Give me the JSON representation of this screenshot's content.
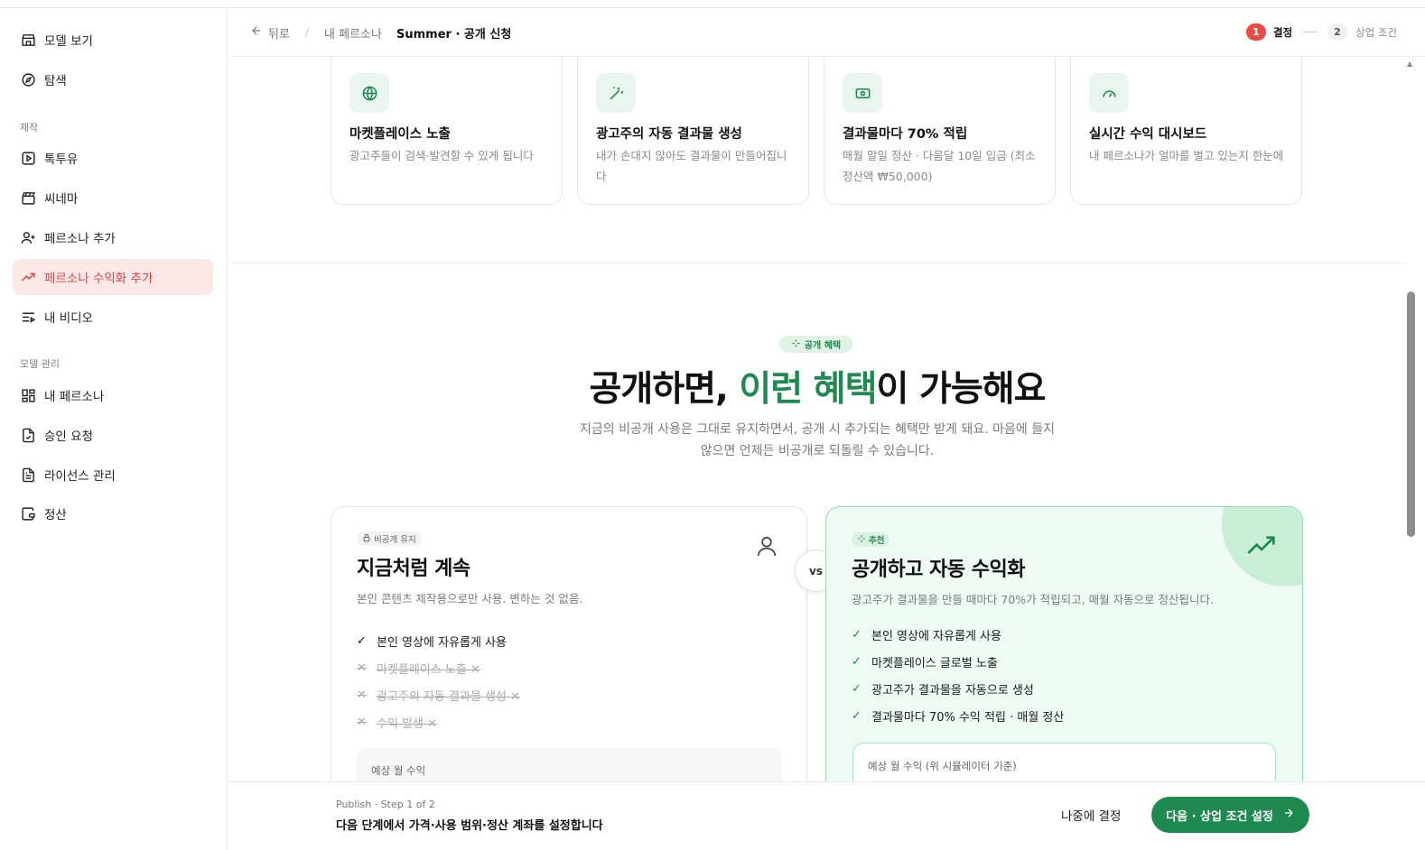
{
  "sidebar": {
    "items_top": [
      {
        "label": "모델 보기",
        "icon": "store-icon"
      },
      {
        "label": "탐색",
        "icon": "compass-icon"
      }
    ],
    "section_make": "제작",
    "items_make": [
      {
        "label": "톡투유",
        "icon": "play-square-icon"
      },
      {
        "label": "씨네마",
        "icon": "clapperboard-icon"
      },
      {
        "label": "페르소나 추가",
        "icon": "user-plus-icon"
      },
      {
        "label": "페르소나 수익화 추가",
        "icon": "trending-up-icon"
      },
      {
        "label": "내 비디오",
        "icon": "video-list-icon"
      }
    ],
    "section_manage": "모델 관리",
    "items_manage": [
      {
        "label": "내 페르소나",
        "icon": "grid-icon"
      },
      {
        "label": "승인 요청",
        "icon": "file-check-icon"
      },
      {
        "label": "라이선스 관리",
        "icon": "file-text-icon"
      },
      {
        "label": "정산",
        "icon": "wallet-icon"
      }
    ]
  },
  "header": {
    "back": "뒤로",
    "crumb_parent": "내 페르소나",
    "crumb_current": "Summer · 공개 신청",
    "steps": [
      {
        "num": "1",
        "label": "결정"
      },
      {
        "num": "2",
        "label": "상업 조건"
      }
    ]
  },
  "features": [
    {
      "icon": "globe-icon",
      "title": "마켓플레이스 노출",
      "desc": "광고주들이 검색·발견할 수 있게 됩니다"
    },
    {
      "icon": "magic-wand-icon",
      "title": "광고주의 자동 결과물 생성",
      "desc": "내가 손대지 않아도 결과물이 만들어집니다"
    },
    {
      "icon": "banknote-icon",
      "title": "결과물마다 70% 적립",
      "desc": "매월 말일 정산 · 다음달 10일 입금 (최소 정산액 ₩50,000)"
    },
    {
      "icon": "gauge-icon",
      "title": "실시간 수익 대시보드",
      "desc": "내 페르소나가 얼마를 벌고 있는지 한눈에"
    }
  ],
  "benefits": {
    "pill": "공개 혜택",
    "headline_a": "공개하면, ",
    "headline_g": "이런 혜택",
    "headline_b": "이 가능해요",
    "sub": "지금의 비공개 사용은 그대로 유지하면서, 공개 시 추가되는 혜택만 받게 돼요. 마음에 들지 않으면 언제든 비공개로 되돌릴 수 있습니다."
  },
  "compare": {
    "left": {
      "tag": "비공개 유지",
      "title": "지금처럼 계속",
      "desc": "본인 콘텐츠 제작용으로만 사용. 변하는 것 없음.",
      "items": [
        {
          "text": "본인 영상에 자유롭게 사용",
          "on": true
        },
        {
          "text": "마켓플레이스 노출 ✕",
          "on": false
        },
        {
          "text": "광고주의 자동 결과물 생성 ✕",
          "on": false
        },
        {
          "text": "수익 발생 ✕",
          "on": false
        }
      ],
      "estimate_label": "예상 월 수익"
    },
    "vs": "vs",
    "right": {
      "tag": "추천",
      "title": "공개하고 자동 수익화",
      "desc": "광고주가 결과물을 만들 때마다 70%가 적립되고, 매월 자동으로 정산됩니다.",
      "items": [
        {
          "text": "본인 영상에 자유롭게 사용"
        },
        {
          "text": "마켓플레이스 글로벌 노출"
        },
        {
          "text": "광고주가 결과물을 자동으로 생성"
        },
        {
          "text": "결과물마다 70% 수익 적립 · 매월 정산"
        }
      ],
      "estimate_label": "예상 월 수익 (위 시뮬레이터 기준)"
    }
  },
  "footer": {
    "step": "Publish · Step 1 of 2",
    "msg": "다음 단계에서 가격·사용 범위·정산 계좌를 설정합니다",
    "later": "나중에 결정",
    "next": "다음 · 상업 조건 설정"
  },
  "colors": {
    "accent": "#1f8a50",
    "active_nav": "#e0433e",
    "active_bg": "#fde8e8"
  }
}
